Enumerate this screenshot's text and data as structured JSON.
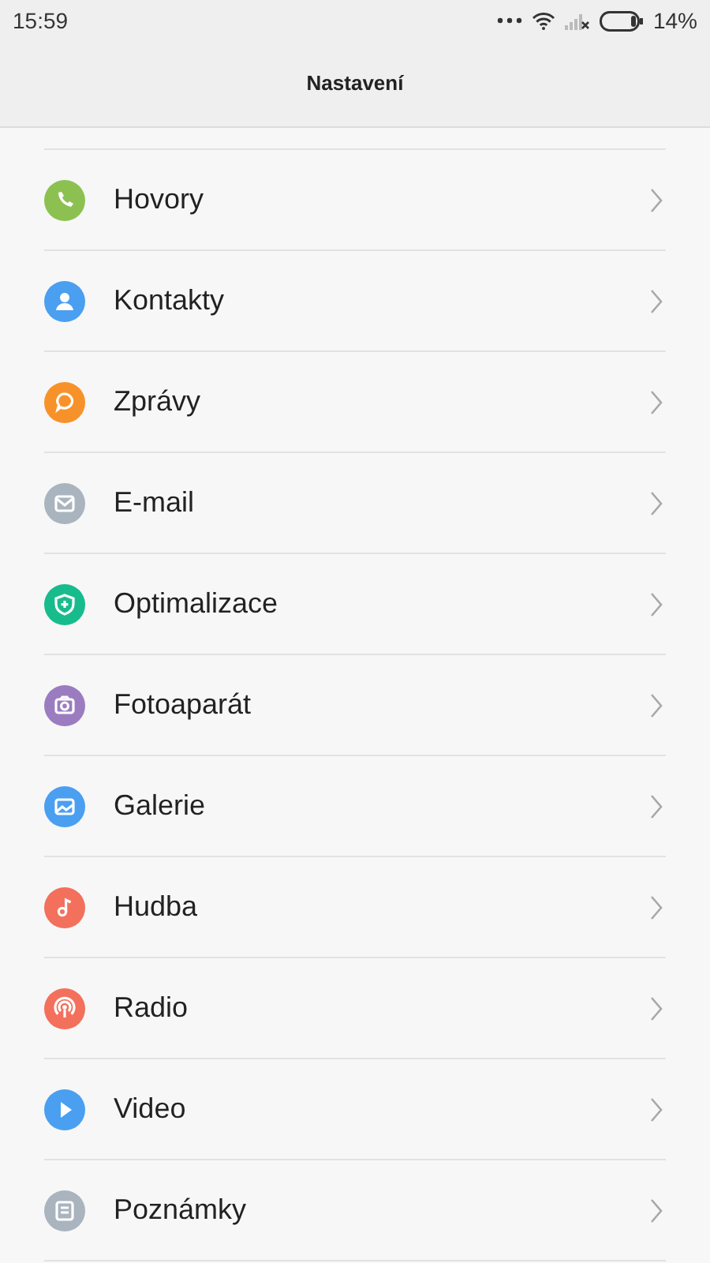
{
  "status_bar": {
    "time": "15:59",
    "battery": "14%"
  },
  "header": {
    "title": "Nastavení"
  },
  "items": [
    {
      "label": "Hovory",
      "kind": "phone",
      "color": "#8cc152"
    },
    {
      "label": "Kontakty",
      "kind": "person",
      "color": "#4a9ff0"
    },
    {
      "label": "Zprávy",
      "kind": "chat",
      "color": "#f7922a"
    },
    {
      "label": "E-mail",
      "kind": "mail",
      "color": "#a9b4bf"
    },
    {
      "label": "Optimalizace",
      "kind": "shield",
      "color": "#18bc8c"
    },
    {
      "label": "Fotoaparát",
      "kind": "camera",
      "color": "#9b7cc1"
    },
    {
      "label": "Galerie",
      "kind": "image",
      "color": "#4a9ff0"
    },
    {
      "label": "Hudba",
      "kind": "note",
      "color": "#f2705c"
    },
    {
      "label": "Radio",
      "kind": "radio",
      "color": "#f2705c"
    },
    {
      "label": "Video",
      "kind": "play",
      "color": "#4a9ff0"
    },
    {
      "label": "Poznámky",
      "kind": "memo",
      "color": "#a9b4bf"
    }
  ]
}
